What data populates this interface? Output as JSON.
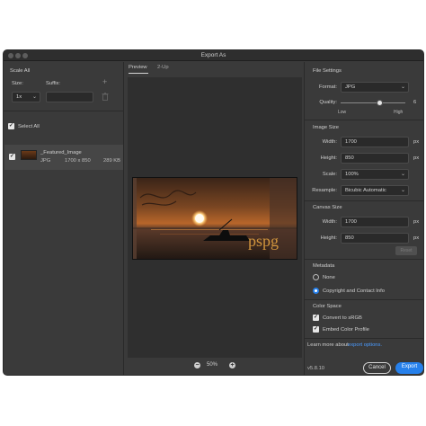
{
  "window": {
    "title": "Export As"
  },
  "left": {
    "scale_all": "Scale All",
    "size_label": "Size:",
    "suffix_label": "Suffix:",
    "size_value": "1x",
    "suffix_value": "",
    "add_icon": "+",
    "select_all": "Select All",
    "asset": {
      "name": "_Featured_Image",
      "format": "JPG",
      "dimensions": "1700 x 850",
      "filesize": "289 KB"
    }
  },
  "center": {
    "tabs": [
      "Preview",
      "2-Up"
    ],
    "zoom": "50%",
    "preview_overlay_text": "pspg"
  },
  "right": {
    "file_settings": {
      "heading": "File Settings",
      "format_label": "Format:",
      "format_value": "JPG",
      "quality_label": "Quality:",
      "quality_value": "6",
      "quality_low": "Low",
      "quality_high": "High",
      "quality_level": 0.6
    },
    "image_size": {
      "heading": "Image Size",
      "width_label": "Width:",
      "width_value": "1700",
      "width_unit": "px",
      "height_label": "Height:",
      "height_value": "850",
      "height_unit": "px",
      "scale_label": "Scale:",
      "scale_value": "100%",
      "resample_label": "Resample:",
      "resample_value": "Bicubic Automatic"
    },
    "canvas_size": {
      "heading": "Canvas Size",
      "width_label": "Width:",
      "width_value": "1700",
      "width_unit": "px",
      "height_label": "Height:",
      "height_value": "850",
      "height_unit": "px",
      "reset_label": "Reset"
    },
    "metadata": {
      "heading": "Metadata",
      "option_none": "None",
      "option_copyright": "Copyright and Contact Info"
    },
    "color_space": {
      "heading": "Color Space",
      "convert_srgb": "Convert to sRGB",
      "embed_profile": "Embed Color Profile"
    },
    "learn_more_prefix": "Learn more about",
    "learn_more_link": "export options.",
    "version": "v5.8.10",
    "cancel_label": "Cancel",
    "export_label": "Export"
  },
  "colors": {
    "accent": "#2680eb",
    "panel": "#3a3a3a",
    "canvas": "#2f2f2f"
  }
}
